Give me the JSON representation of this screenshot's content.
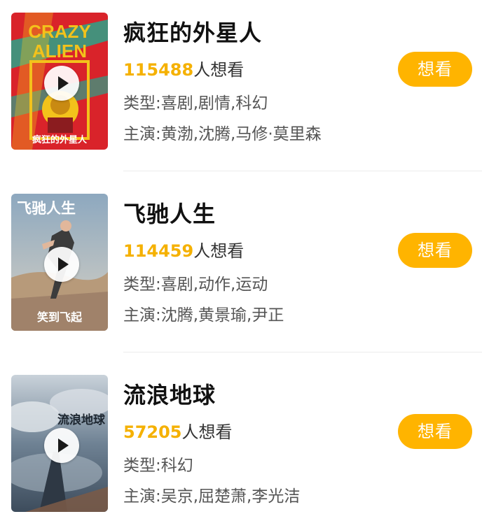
{
  "movies": [
    {
      "title": "疯狂的外星人",
      "want_count": "115488",
      "want_suffix": "人想看",
      "genre_text": "类型:喜剧,剧情,科幻",
      "cast_text": "主演:黄渤,沈腾,马修·莫里森",
      "button_label": "想看",
      "poster_text_line1": "CRAZY",
      "poster_text_line2": "ALIEN",
      "poster_caption": "疯狂的外星人",
      "poster_colors": {
        "primary": "#d9232a",
        "secondary": "#2aa38a",
        "accent": "#f3c21b"
      }
    },
    {
      "title": "飞驰人生",
      "want_count": "114459",
      "want_suffix": "人想看",
      "genre_text": "类型:喜剧,动作,运动",
      "cast_text": "主演:沈腾,黄景瑜,尹正",
      "button_label": "想看",
      "poster_title": "飞驰人生",
      "poster_caption": "笑到飞起",
      "poster_colors": {
        "sky": "#9fb6c9",
        "ground": "#b79a7a"
      }
    },
    {
      "title": "流浪地球",
      "want_count": "57205",
      "want_suffix": "人想看",
      "genre_text": "类型:科幻",
      "cast_text": "主演:吴京,屈楚萧,李光洁",
      "button_label": "想看",
      "poster_title": "流浪地球",
      "poster_colors": {
        "sky": "#55667a",
        "clouds": "#c7d0d8"
      }
    }
  ],
  "colors": {
    "accent": "#ffb400",
    "count": "#f5b100",
    "title": "#111111",
    "meta": "#555555",
    "divider": "#ececec"
  },
  "icons": {
    "play": "play-icon"
  }
}
